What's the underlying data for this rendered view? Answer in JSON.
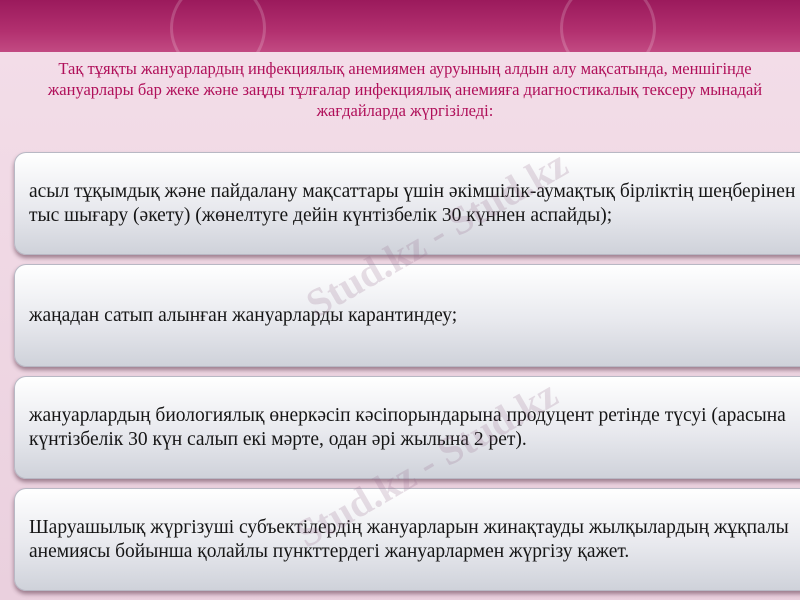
{
  "header": {
    "text": "Тақ тұяқты жануарлардың инфекциялық анемиямен ауруының алдын алу мақсатында, меншігінде жануарлары бар жеке және заңды тұлғалар инфекциялық анемияға диагностикалық тексеру мынадай жағдайларда жүргізіледі:"
  },
  "items": [
    "асыл тұқымдық және пайдалану мақсаттары үшін әкімшілік-аумақтық бірліктің шеңберінен тыс шығару (әкету) (жөнелтуге дейін күнтізбелік 30 күннен аспайды);",
    "жаңадан сатып алынған жануарларды карантиндеу;",
    "жануарлардың биологиялық өнеркәсіп кәсіпорындарына продуцент ретінде түсуі (арасына күнтізбелік 30 күн салып екі мәрте, одан әрі жылына 2 рет).",
    "Шаруашылық жүргізуші субъектілердің жануарларын жинақтауды жылқылардың жұқпалы анемиясы бойынша қолайлы пункттердегі жануарлармен жүргізу қажет."
  ],
  "watermark": "Stud.kz - Stud.kz"
}
